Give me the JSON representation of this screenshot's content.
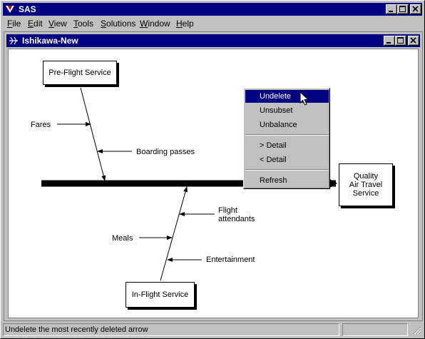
{
  "app": {
    "title": "SAS"
  },
  "menubar": {
    "items": [
      {
        "label": "File",
        "u": "F",
        "rest": "ile"
      },
      {
        "label": "Edit",
        "u": "E",
        "rest": "dit"
      },
      {
        "label": "View",
        "u": "V",
        "rest": "iew"
      },
      {
        "label": "Tools",
        "u": "T",
        "rest": "ools"
      },
      {
        "label": "Solutions",
        "u": "S",
        "rest": "olutions"
      },
      {
        "label": "Window",
        "u": "W",
        "rest": "indow"
      },
      {
        "label": "Help",
        "u": "H",
        "rest": "elp"
      }
    ]
  },
  "child_window": {
    "title": "Ishikawa-New"
  },
  "diagram": {
    "boxes": {
      "preflight": "Pre-Flight Service",
      "inflight": "In-Flight Service",
      "effect": "Quality\nAir Travel\nService"
    },
    "labels": {
      "fares": "Fares",
      "boarding": "Boarding passes",
      "flight_attendants": "Flight\nattendants",
      "meals": "Meals",
      "entertainment": "Entertainment"
    }
  },
  "context_menu": {
    "items": {
      "undelete": "Undelete",
      "unsubset": "Unsubset",
      "unbalance": "Unbalance",
      "more_detail": "> Detail",
      "less_detail": "< Detail",
      "refresh": "Refresh"
    }
  },
  "status": {
    "message": "Undelete the most recently deleted arrow"
  },
  "colors": {
    "titlebar": "#000080",
    "face": "#c0c0c0",
    "highlight": "#000080"
  }
}
